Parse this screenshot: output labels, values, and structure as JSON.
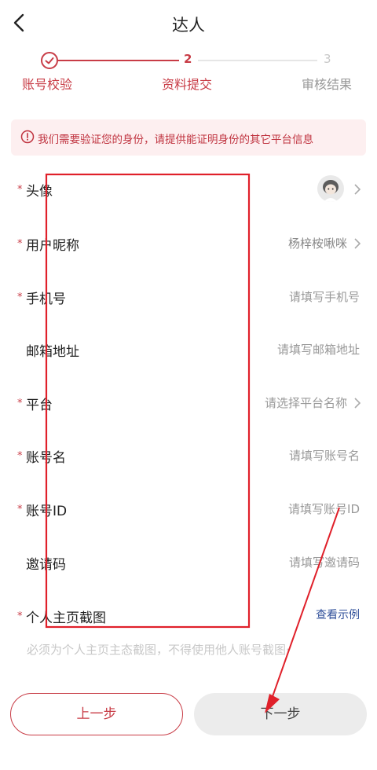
{
  "header": {
    "title": "达人",
    "back_icon": "chevron-left-icon"
  },
  "steps": [
    {
      "label": "账号校验",
      "state": "done",
      "icon": "check-circle-icon"
    },
    {
      "number": "2",
      "label": "资料提交",
      "state": "active"
    },
    {
      "number": "3",
      "label": "审核结果",
      "state": "pending"
    }
  ],
  "notice": {
    "icon": "alert-circle-icon",
    "text": "我们需要验证您的身份，请提供能证明身份的其它平台信息"
  },
  "form": {
    "avatar": {
      "required": "*",
      "label": "头像",
      "avatar_icon": "avatar-image"
    },
    "nickname": {
      "required": "*",
      "label": "用户昵称",
      "value": "杨梓桉啾咪"
    },
    "phone": {
      "required": "*",
      "label": "手机号",
      "placeholder": "请填写手机号"
    },
    "email": {
      "label": "邮箱地址",
      "placeholder": "请填写邮箱地址"
    },
    "platform": {
      "required": "*",
      "label": "平台",
      "placeholder": "请选择平台名称"
    },
    "account_name": {
      "required": "*",
      "label": "账号名",
      "placeholder": "请填写账号名"
    },
    "account_id": {
      "required": "*",
      "label": "账号ID",
      "placeholder": "请填写账号ID"
    },
    "invite_code": {
      "label": "邀请码",
      "placeholder": "请填写邀请码"
    },
    "homepage_screenshot": {
      "required": "*",
      "label": "个人主页截图",
      "example_link": "查看示例",
      "hint": "必须为个人主页主态截图，不得使用他人账号截图·"
    }
  },
  "buttons": {
    "prev": "上一步",
    "next": "下一步"
  },
  "colors": {
    "accent": "#c83c46",
    "link": "#2f4f9a",
    "annotation": "#e0202a"
  }
}
